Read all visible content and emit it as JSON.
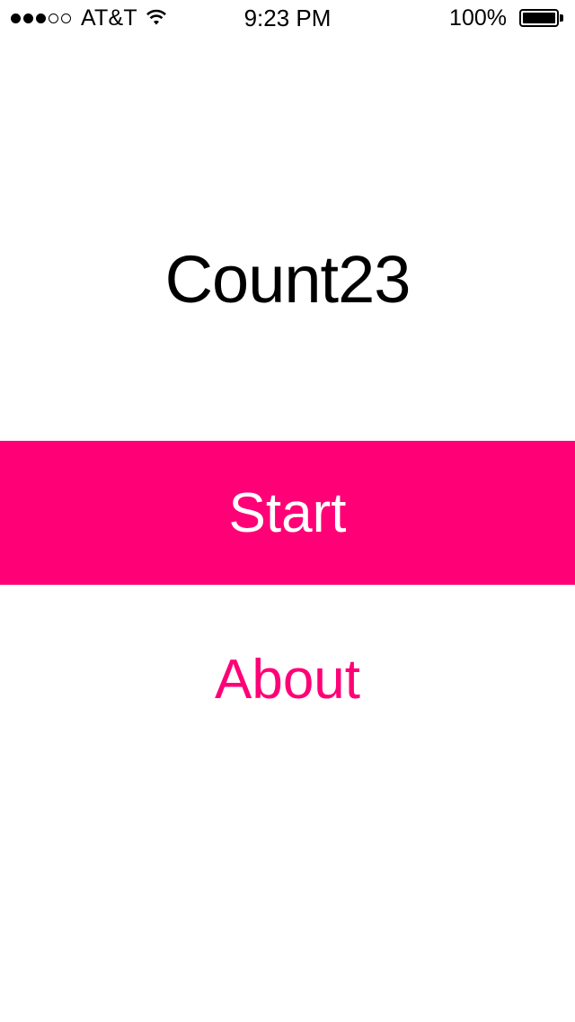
{
  "status_bar": {
    "signal_bars_filled": 3,
    "signal_bars_total": 5,
    "carrier": "AT&T",
    "wifi_icon": "wifi-icon",
    "time": "9:23 PM",
    "battery_percent": "100%",
    "battery_level": 1.0,
    "battery_icon": "battery-icon"
  },
  "main": {
    "title": "Count23",
    "start_label": "Start",
    "about_label": "About"
  },
  "colors": {
    "accent": "#ff0077",
    "background": "#ffffff",
    "text": "#000000",
    "button_text": "#ffffff"
  }
}
